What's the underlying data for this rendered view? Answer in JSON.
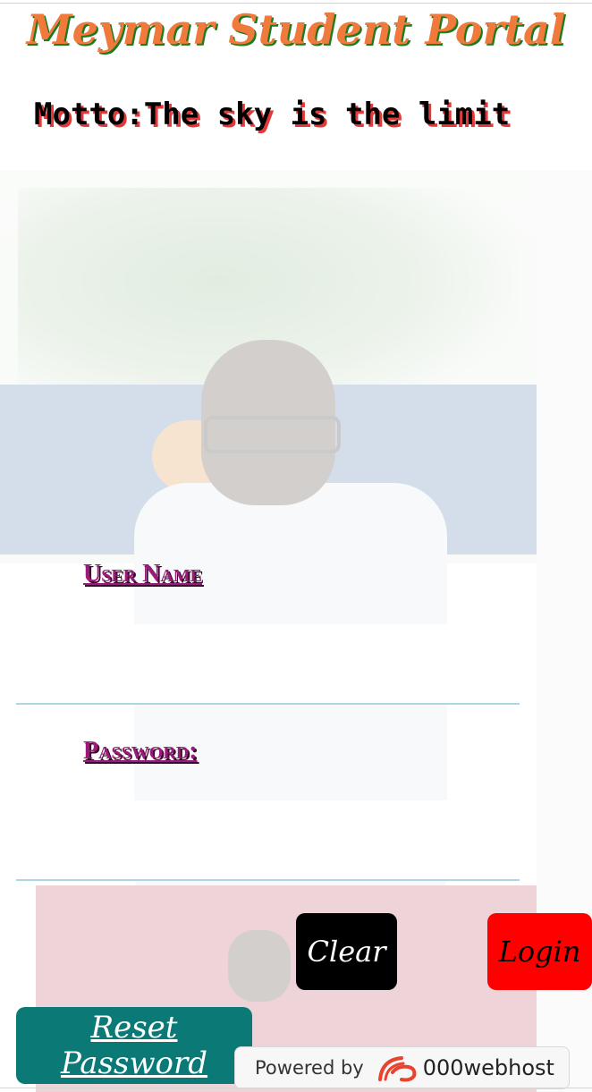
{
  "header": {
    "title": "Meymar Student Portal",
    "motto": "Motto:The sky is the limit"
  },
  "form": {
    "username_label": "User Name",
    "password_label": "Password:",
    "username_value": "",
    "password_value": ""
  },
  "buttons": {
    "clear": "Clear",
    "login": "Login",
    "reset": "Reset Password"
  },
  "footer": {
    "powered_by": "Powered by",
    "brand": "000webhost",
    "logo_icon": "000webhost-logo-icon"
  },
  "colors": {
    "title": "#f07a3b",
    "title_shadow": "#1d7a1d",
    "label": "#9b1a7a",
    "login_bg": "#ff0000",
    "clear_bg": "#000000",
    "reset_bg": "#0b7a76",
    "field_underline": "#aed6e6"
  }
}
